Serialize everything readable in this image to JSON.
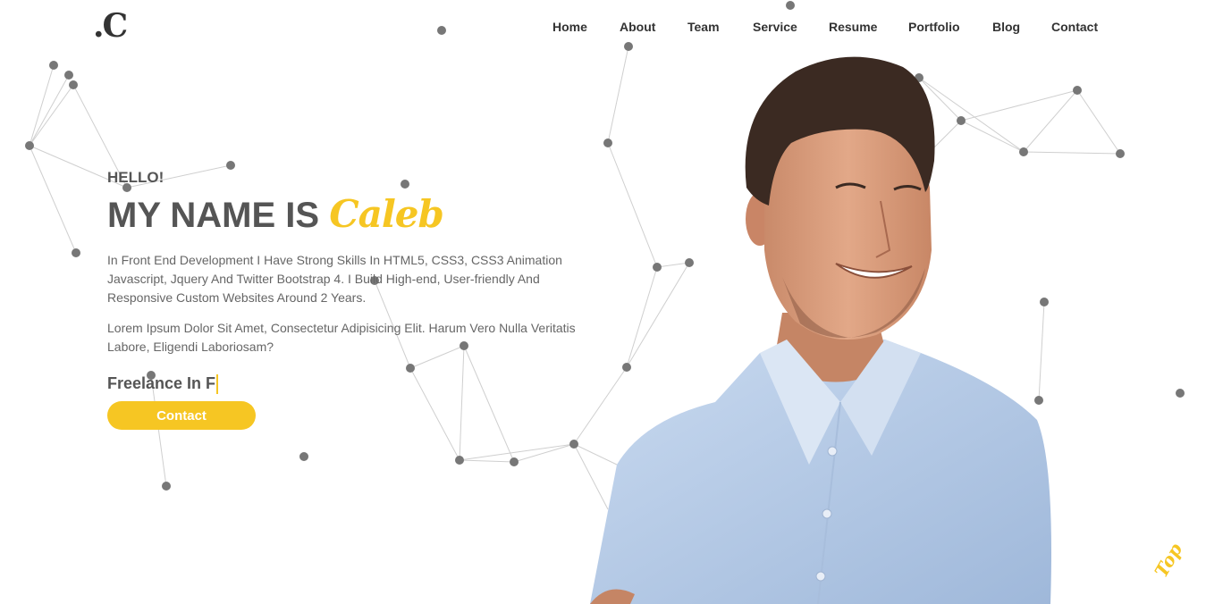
{
  "logo": {
    "text": ".C"
  },
  "nav": {
    "items": [
      {
        "label": "Home"
      },
      {
        "label": "About"
      },
      {
        "label": "Team"
      },
      {
        "label": "Service"
      },
      {
        "label": "Resume"
      },
      {
        "label": "Portfolio"
      },
      {
        "label": "Blog"
      },
      {
        "label": "Contact"
      }
    ]
  },
  "hero": {
    "greeting": "HELLO!",
    "headline_prefix": "MY NAME IS",
    "name": "Caleb",
    "paragraph_1": "In Front End Development I Have Strong Skills In HTML5, CSS3, CSS3 Animation Javascript, Jquery And Twitter Bootstrap 4. I Build High-end, User-friendly And Responsive Custom Websites Around 2 Years.",
    "paragraph_2": "Lorem Ipsum Dolor Sit Amet, Consectetur Adipisicing Elit. Harum Vero Nulla Veritatis Labore, Eligendi Laboriosam?",
    "typed_text": "Freelance In F",
    "contact_label": "Contact"
  },
  "top_button": {
    "label": "Top"
  },
  "colors": {
    "accent": "#f6c623",
    "text_dark": "#555555",
    "particle": "#777777"
  },
  "icons": {
    "portrait": "person-portrait",
    "network": "particle-network"
  }
}
